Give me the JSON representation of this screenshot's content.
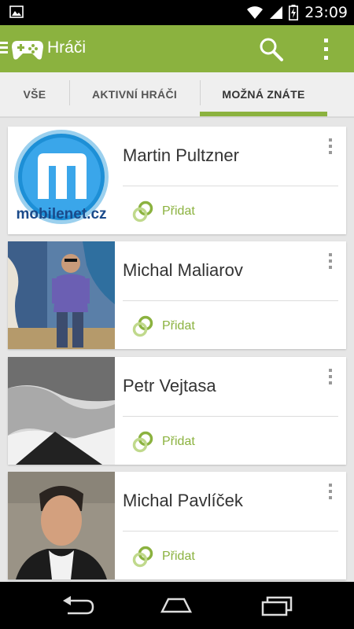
{
  "status_bar": {
    "time": "23:09"
  },
  "app_bar": {
    "title": "Hráči"
  },
  "tabs": [
    {
      "label": "VŠE",
      "selected": false
    },
    {
      "label": "AKTIVNÍ HRÁČI",
      "selected": false
    },
    {
      "label": "MOŽNÁ ZNÁTE",
      "selected": true
    }
  ],
  "players": [
    {
      "name": "Martin Pultzner",
      "add_label": "Přidat",
      "avatar_text": "mobilenet.cz"
    },
    {
      "name": "Michal Maliarov",
      "add_label": "Přidat"
    },
    {
      "name": "Petr Vejtasa",
      "add_label": "Přidat"
    },
    {
      "name": "Michal Pavlíček",
      "add_label": "Přidat"
    }
  ],
  "colors": {
    "accent": "#8bb23f",
    "status_bar": "#000000",
    "background": "#e6e6e6"
  }
}
